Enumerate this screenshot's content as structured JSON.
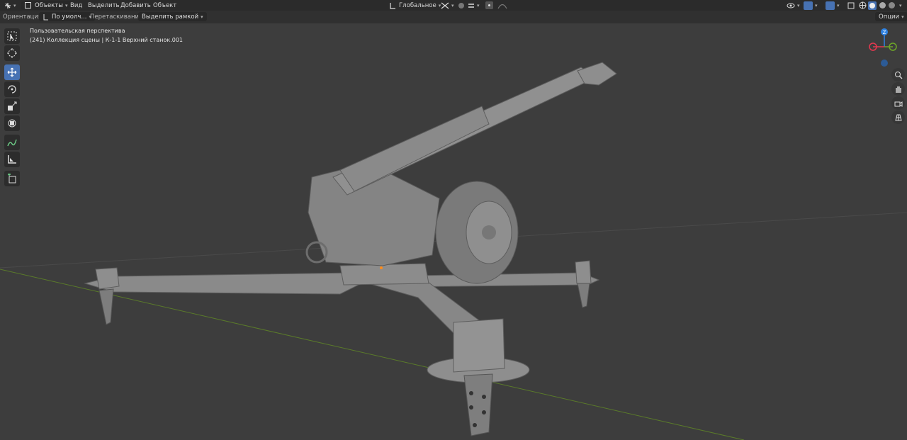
{
  "header": {
    "mode_label": "Объекты",
    "menu": [
      "Вид",
      "Выделить",
      "Добавить",
      "Объект"
    ],
    "transform_orientation": "Глобальное",
    "options_label": "Опции"
  },
  "tool_header": {
    "orientation_label": "Ориентация:",
    "orientation_value": "По умолч...",
    "drag_label": "Перетаскивание:",
    "drag_value": "Выделить рамкой"
  },
  "viewport": {
    "view_name": "Пользовательская перспектива",
    "object_info": "(241) Коллекция сцены | К-1-1 Верхний станок.001"
  },
  "toolbar": {
    "tools": [
      "select-box",
      "cursor",
      "move",
      "rotate",
      "scale",
      "transform",
      "annotate",
      "measure",
      "add-cube"
    ],
    "active_tool": "move"
  },
  "gizmo": {
    "axes": [
      "X",
      "Y",
      "Z"
    ],
    "colors": {
      "x": "#e8384f",
      "y": "#6ea628",
      "z": "#2f83e3"
    }
  },
  "colors": {
    "accent": "#4772b3",
    "background": "#3d3d3d",
    "header": "#2b2b2b"
  }
}
